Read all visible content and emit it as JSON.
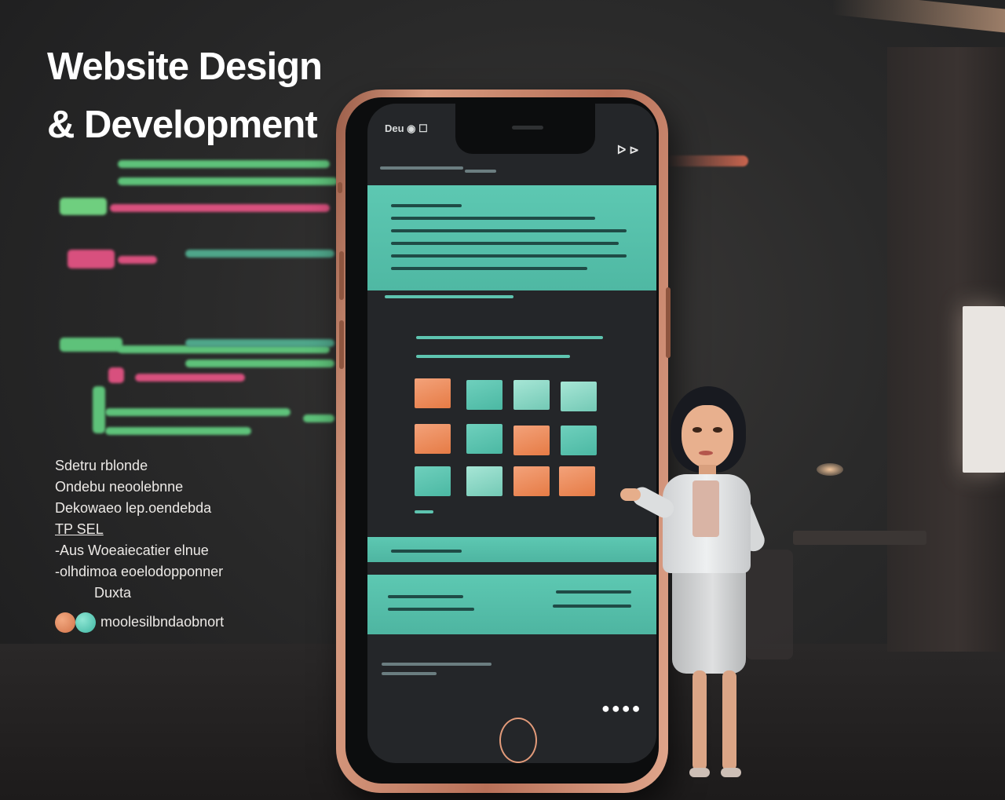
{
  "heading": {
    "line1": "Website Design",
    "line2": "& Development"
  },
  "description": {
    "lines": [
      "Sdetru rblonde",
      "Ondebu neoolebnne",
      "Dekowaeo lep.oendebda",
      "TP SEL",
      "-Aus Woeaiecatier elnue",
      "-olhdimoa eoelodopponner",
      "Duxta"
    ],
    "contact_text": "moolesilbndaobnort"
  },
  "phone": {
    "status_left": "Deu ◉ ☐",
    "status_right": "ᐅ ⊳",
    "nav_text": "◎ ··· ⊟",
    "pager_dots": "●●●●"
  },
  "colors": {
    "accent_teal": "#5ec4b0",
    "accent_orange": "#e67b45",
    "phone_frame": "#c98568",
    "background": "#2a2a2a"
  }
}
